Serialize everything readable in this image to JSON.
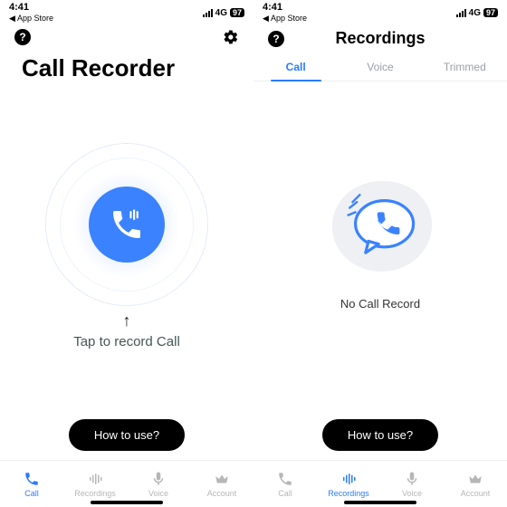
{
  "statusbar": {
    "time": "4:41",
    "back": "App Store",
    "network": "4G",
    "battery": "97"
  },
  "left": {
    "title": "Call Recorder",
    "tap_label": "Tap to record Call",
    "howto": "How to use?",
    "nav": [
      "Call",
      "Recordings",
      "Voice",
      "Account"
    ]
  },
  "right": {
    "title": "Recordings",
    "tabs": [
      "Call",
      "Voice",
      "Trimmed"
    ],
    "empty": "No Call Record",
    "howto": "How to use?",
    "nav": [
      "Call",
      "Recordings",
      "Voice",
      "Account"
    ]
  }
}
